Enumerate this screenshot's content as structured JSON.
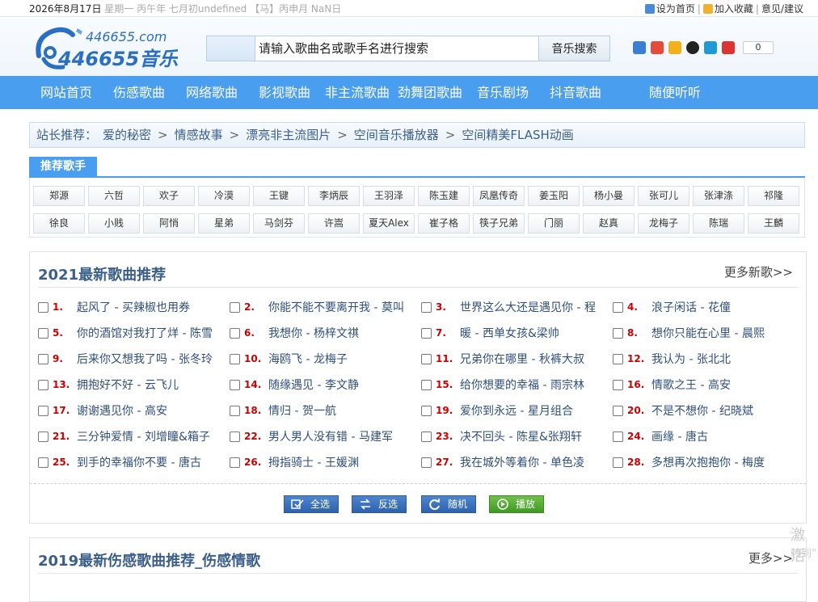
{
  "topbar": {
    "date": "2026年8月17日",
    "lunar": "星期一  丙午年 七月初undefined 【马】丙申月 NaN日",
    "links": [
      "设为首页",
      "加入收藏",
      "意见/建议"
    ]
  },
  "logo": {
    "domain": "446655.com",
    "name": "446655音乐"
  },
  "search": {
    "placeholder": "请输入歌曲名或歌手名进行搜索",
    "button": "音乐搜索"
  },
  "share": {
    "count": "0"
  },
  "nav": [
    "网站首页",
    "伤感歌曲",
    "网络歌曲",
    "影视歌曲",
    "非主流歌曲",
    "劲舞团歌曲",
    "音乐剧场",
    "抖音歌曲",
    "随便听听"
  ],
  "recommend": {
    "label": "站长推荐：",
    "items": [
      "爱的秘密",
      "情感故事",
      "漂亮非主流图片",
      "空间音乐播放器",
      "空间精美FLASH动画"
    ],
    "arrow": ">"
  },
  "singers": {
    "tab": "推荐歌手",
    "row1": [
      "郑源",
      "六哲",
      "欢子",
      "冷漠",
      "王键",
      "李炳辰",
      "王羽泽",
      "陈玉建",
      "凤凰传奇",
      "姜玉阳",
      "杨小曼",
      "张可儿",
      "张津涤",
      "祁隆"
    ],
    "row2": [
      "徐良",
      "小贱",
      "阿悄",
      "星弟",
      "马剑芬",
      "许嵩",
      "夏天Alex",
      "崔子格",
      "筷子兄弟",
      "门丽",
      "赵真",
      "龙梅子",
      "陈瑞",
      "王麟"
    ]
  },
  "section1": {
    "title": "2021最新歌曲推荐",
    "more": "更多新歌>>",
    "songs": [
      {
        "n": "1.",
        "t": "起风了 - 买辣椒也用券"
      },
      {
        "n": "2.",
        "t": "你能不能不要离开我 - 莫叫"
      },
      {
        "n": "3.",
        "t": "世界这么大还是遇见你 - 程"
      },
      {
        "n": "4.",
        "t": "浪子闲话 - 花僮"
      },
      {
        "n": "5.",
        "t": "你的酒馆对我打了烊 - 陈雪"
      },
      {
        "n": "6.",
        "t": "我想你 - 杨梓文祺"
      },
      {
        "n": "7.",
        "t": "暖 - 西单女孩&梁帅"
      },
      {
        "n": "8.",
        "t": "想你只能在心里 - 晨熙"
      },
      {
        "n": "9.",
        "t": "后来你又想我了吗 - 张冬玲"
      },
      {
        "n": "10.",
        "t": "海鸥飞 - 龙梅子"
      },
      {
        "n": "11.",
        "t": "兄弟你在哪里 - 秋裤大叔"
      },
      {
        "n": "12.",
        "t": "我认为 - 张北北"
      },
      {
        "n": "13.",
        "t": "拥抱好不好 - 云飞儿"
      },
      {
        "n": "14.",
        "t": "随缘遇见 - 李文静"
      },
      {
        "n": "15.",
        "t": "给你想要的幸福 - 雨宗林"
      },
      {
        "n": "16.",
        "t": "情歌之王 - 高安"
      },
      {
        "n": "17.",
        "t": "谢谢遇见你 - 高安"
      },
      {
        "n": "18.",
        "t": "情归 - 贺一航"
      },
      {
        "n": "19.",
        "t": "爱你到永远 - 星月组合"
      },
      {
        "n": "20.",
        "t": "不是不想你 - 纪晓斌"
      },
      {
        "n": "21.",
        "t": "三分钟爱情 - 刘增瞳&箱子"
      },
      {
        "n": "22.",
        "t": "男人男人没有错 - 马建军"
      },
      {
        "n": "23.",
        "t": "决不回头 - 陈星&张翔轩"
      },
      {
        "n": "24.",
        "t": "画缘 - 唐古"
      },
      {
        "n": "25.",
        "t": "到手的幸福你不要 - 唐古"
      },
      {
        "n": "26.",
        "t": "拇指骑士 - 王媛渊"
      },
      {
        "n": "27.",
        "t": "我在城外等着你 - 单色凌"
      },
      {
        "n": "28.",
        "t": "多想再次抱抱你 - 梅度"
      }
    ],
    "buttons": {
      "select_all": "全选",
      "invert": "反选",
      "random": "随机",
      "play": "播放"
    }
  },
  "section2": {
    "title": "2019最新伤感歌曲推荐_伤感情歌",
    "more": "更多>>"
  },
  "side": {
    "activate": "激活",
    "goto": "转到“"
  },
  "colors": {
    "nav": "#4a9ef0",
    "title": "#3b5f8a",
    "num": "#cc0000"
  }
}
